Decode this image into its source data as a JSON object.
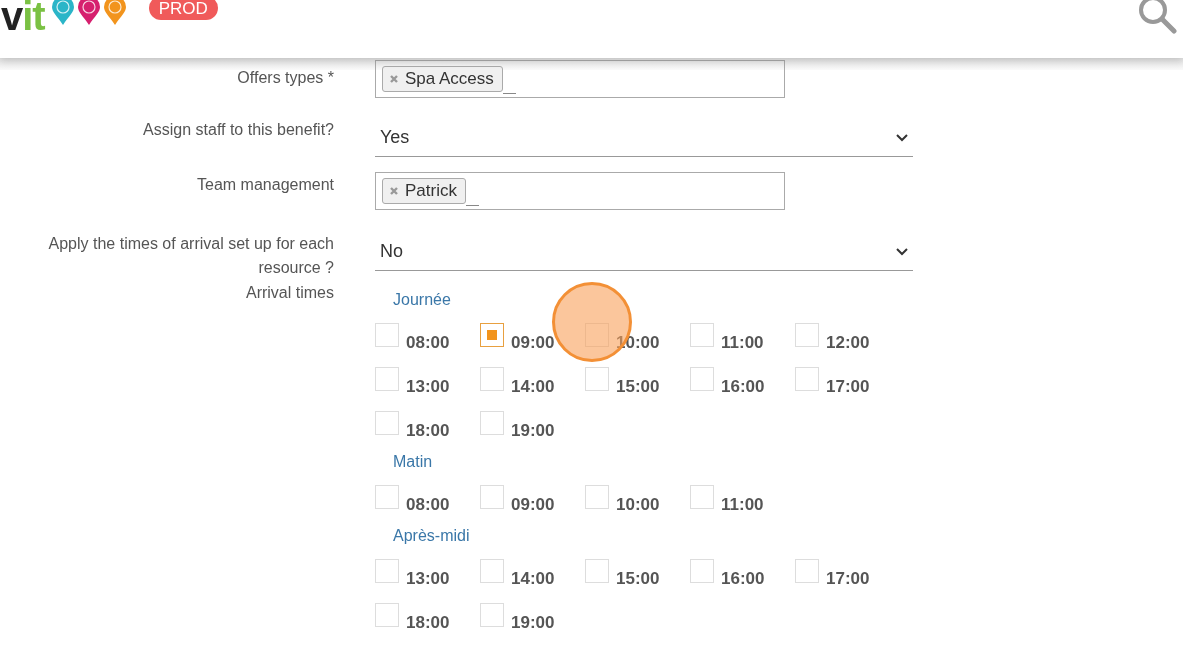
{
  "header": {
    "logo": "vit",
    "environment_badge": "PROD"
  },
  "form": {
    "rows": [
      {
        "kind": "tags",
        "label": "Offers types *",
        "tags": [
          "Spa Access"
        ]
      },
      {
        "kind": "select",
        "label": "Assign staff to this benefit?",
        "value": "Yes"
      },
      {
        "kind": "tags",
        "label": "Team management",
        "tags": [
          "Patrick"
        ]
      },
      {
        "kind": "select",
        "label": "Apply the times of arrival set up for each resource ?",
        "value": "No"
      }
    ],
    "arrival_times": {
      "label": "Arrival times",
      "groups": [
        {
          "title": "Journée",
          "times": [
            {
              "label": "08:00",
              "checked": false
            },
            {
              "label": "09:00",
              "checked": true
            },
            {
              "label": "10:00",
              "checked": false
            },
            {
              "label": "11:00",
              "checked": false
            },
            {
              "label": "12:00",
              "checked": false
            },
            {
              "label": "13:00",
              "checked": false
            },
            {
              "label": "14:00",
              "checked": false
            },
            {
              "label": "15:00",
              "checked": false
            },
            {
              "label": "16:00",
              "checked": false
            },
            {
              "label": "17:00",
              "checked": false
            },
            {
              "label": "18:00",
              "checked": false
            },
            {
              "label": "19:00",
              "checked": false
            }
          ]
        },
        {
          "title": "Matin",
          "times": [
            {
              "label": "08:00",
              "checked": false
            },
            {
              "label": "09:00",
              "checked": false
            },
            {
              "label": "10:00",
              "checked": false
            },
            {
              "label": "11:00",
              "checked": false
            }
          ]
        },
        {
          "title": "Après-midi",
          "times": [
            {
              "label": "13:00",
              "checked": false
            },
            {
              "label": "14:00",
              "checked": false
            },
            {
              "label": "15:00",
              "checked": false
            },
            {
              "label": "16:00",
              "checked": false
            },
            {
              "label": "17:00",
              "checked": false
            },
            {
              "label": "18:00",
              "checked": false
            },
            {
              "label": "19:00",
              "checked": false
            }
          ]
        }
      ]
    }
  }
}
